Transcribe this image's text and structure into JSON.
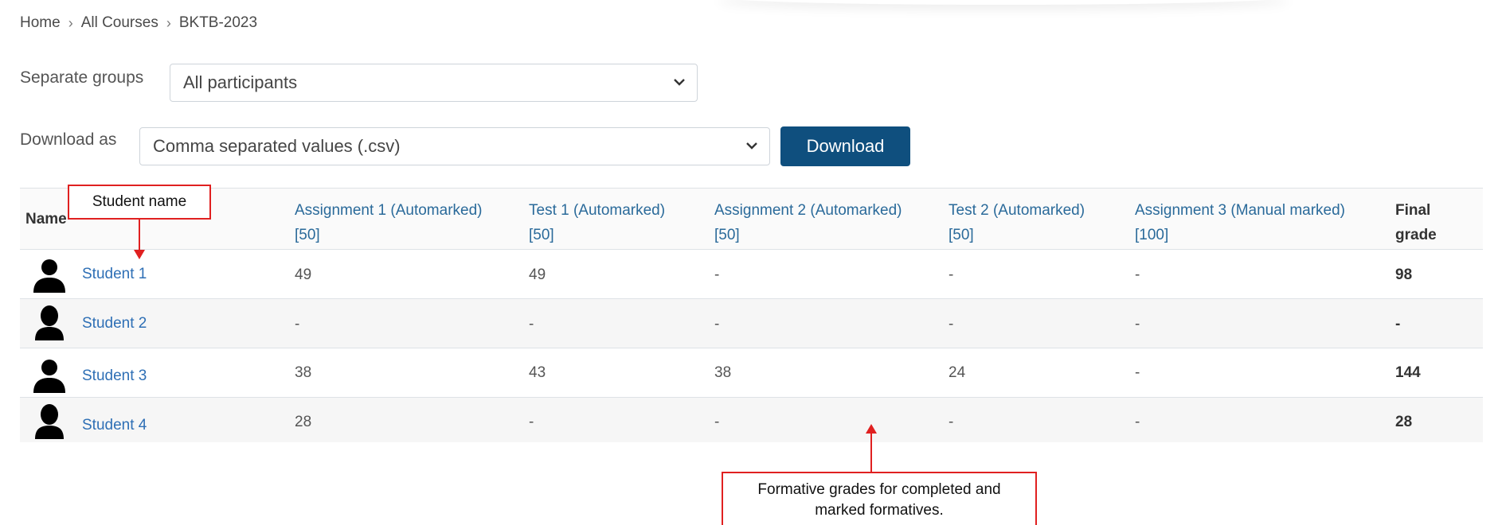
{
  "breadcrumb": {
    "items": [
      "Home",
      "All Courses",
      "BKTB-2023"
    ]
  },
  "groups": {
    "label": "Separate groups",
    "selected": "All participants"
  },
  "download": {
    "label": "Download as",
    "selected": "Comma separated values (.csv)",
    "button_label": "Download"
  },
  "table": {
    "name_header": "Name",
    "final_header": "Final grade",
    "columns": [
      {
        "title": "Assignment 1 (Automarked)",
        "max": "[50]"
      },
      {
        "title": "Test 1 (Automarked)",
        "max": "[50]"
      },
      {
        "title": "Assignment 2 (Automarked)",
        "max": "[50]"
      },
      {
        "title": "Test 2 (Automarked)",
        "max": "[50]"
      },
      {
        "title": "Assignment 3 (Manual marked)",
        "max": "[100]"
      }
    ],
    "rows": [
      {
        "name": "Student 1",
        "grades": [
          "49",
          "49",
          "-",
          "-",
          "-"
        ],
        "final": "98"
      },
      {
        "name": "Student 2",
        "grades": [
          "-",
          "-",
          "-",
          "-",
          "-"
        ],
        "final": "-"
      },
      {
        "name": "Student 3",
        "grades": [
          "38",
          "43",
          "38",
          "24",
          "-"
        ],
        "final": "144"
      },
      {
        "name": "Student 4",
        "grades": [
          "28",
          "-",
          "-",
          "-",
          "-"
        ],
        "final": "28"
      }
    ]
  },
  "annotations": {
    "student_name": "Student name",
    "formative_line1": "Formative grades for completed and",
    "formative_line2": "marked formatives."
  },
  "colors": {
    "accent_button": "#0f4f7e",
    "link": "#2e6fb5",
    "annotation": "#e02020"
  }
}
